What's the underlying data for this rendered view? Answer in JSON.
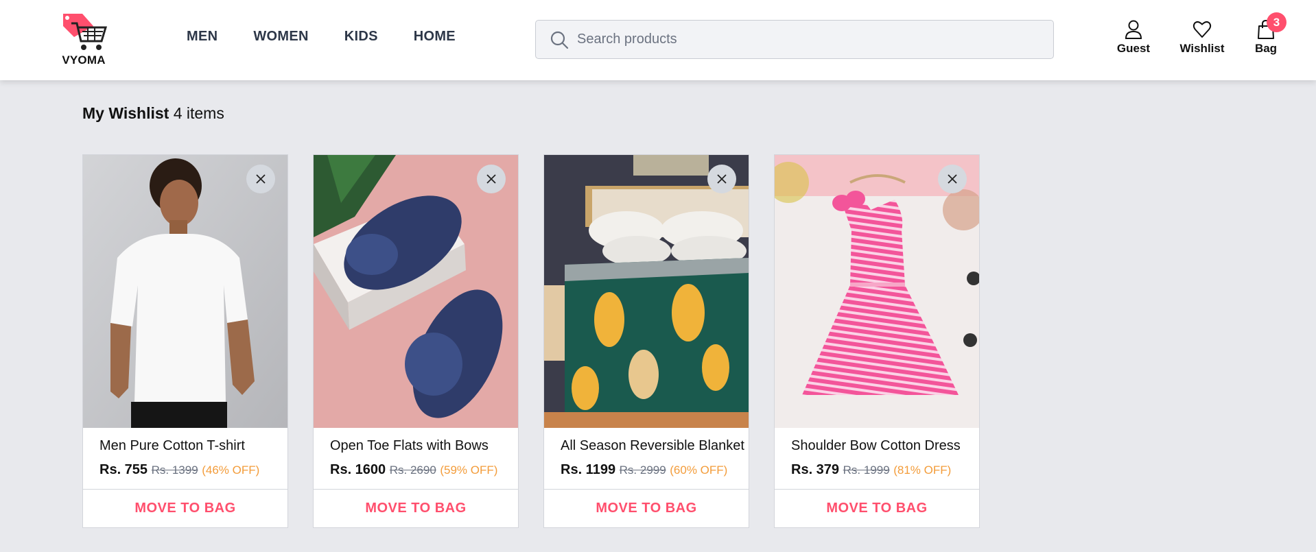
{
  "brand": {
    "name": "VYOMA"
  },
  "nav": {
    "items": [
      "MEN",
      "WOMEN",
      "KIDS",
      "HOME"
    ]
  },
  "search": {
    "placeholder": "Search products",
    "value": ""
  },
  "actions": {
    "guest": "Guest",
    "wishlist": "Wishlist",
    "bag": "Bag",
    "bag_count": "3"
  },
  "wishlist": {
    "title": "My Wishlist",
    "count_text": "4 items",
    "items": [
      {
        "name": "Men Pure Cotton T-shirt",
        "price": "Rs. 755",
        "original_price": "Rs. 1399",
        "discount": "(46% OFF)",
        "button": "MOVE TO BAG"
      },
      {
        "name": "Open Toe Flats with Bows",
        "price": "Rs. 1600",
        "original_price": "Rs. 2690",
        "discount": "(59% OFF)",
        "button": "MOVE TO BAG"
      },
      {
        "name": "All Season Reversible Blanket",
        "price": "Rs. 1199",
        "original_price": "Rs. 2999",
        "discount": "(60% OFF)",
        "button": "MOVE TO BAG"
      },
      {
        "name": "Shoulder Bow Cotton Dress",
        "price": "Rs. 379",
        "original_price": "Rs. 1999",
        "discount": "(81% OFF)",
        "button": "MOVE TO BAG"
      }
    ]
  },
  "colors": {
    "accent": "#ff4f6d",
    "discount": "#f39c3a",
    "background": "#e8e9ed"
  }
}
